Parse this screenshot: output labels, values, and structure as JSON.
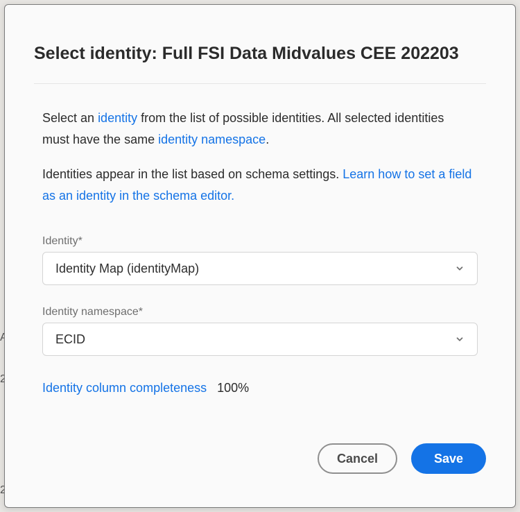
{
  "modal": {
    "title": "Select identity: Full FSI Data Midvalues CEE 202203",
    "desc1_a": "Select an ",
    "desc1_link1": "identity",
    "desc1_b": " from the list of possible identities. All selected identities must have the same ",
    "desc1_link2": "identity namespace",
    "desc1_c": ".",
    "desc2_a": "Identities appear in the list based on schema settings. ",
    "desc2_link": "Learn how to set a field as an identity in the schema editor."
  },
  "form": {
    "identity": {
      "label": "Identity*",
      "value": "Identity Map (identityMap)"
    },
    "namespace": {
      "label": "Identity namespace*",
      "value": "ECID"
    },
    "completeness": {
      "label": "Identity column completeness",
      "value": "100%"
    }
  },
  "actions": {
    "cancel": "Cancel",
    "save": "Save"
  },
  "bg": {
    "r1": "A",
    "r2": "2",
    "r3": "2"
  }
}
